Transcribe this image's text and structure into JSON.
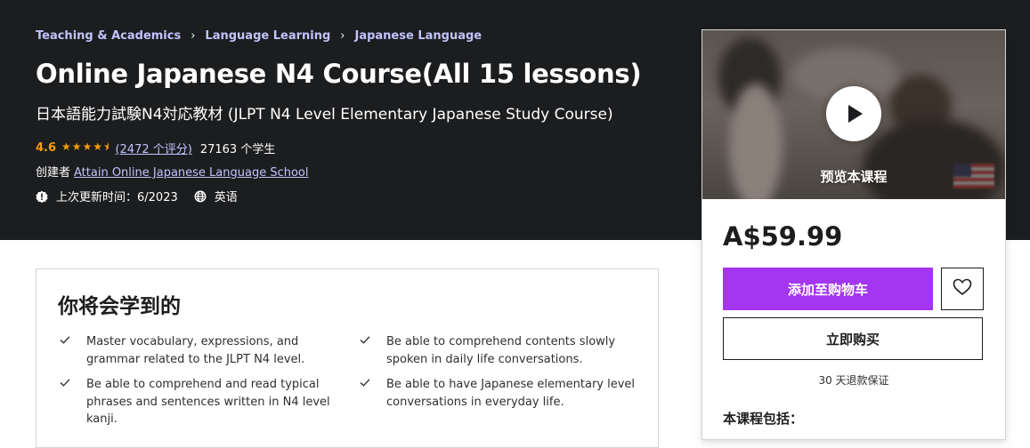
{
  "breadcrumbs": [
    "Teaching & Academics",
    "Language Learning",
    "Japanese Language"
  ],
  "course": {
    "title": "Online Japanese N4 Course(All 15 lessons)",
    "subtitle": "日本語能力試験N4対応教材 (JLPT N4 Level Elementary Japanese Study Course)",
    "rating": "4.6",
    "stars_value": 4.6,
    "rating_count": "(2472 个评分)",
    "students": "27163 个学生",
    "creator_label": "创建者",
    "creator_name": "Attain Online Japanese Language School",
    "last_updated": "上次更新时间：6/2023",
    "language": "英语"
  },
  "learn": {
    "heading": "你将会学到的",
    "items": [
      "Master vocabulary, expressions, and grammar related to the JLPT N4 level.",
      "Be able to comprehend contents slowly spoken in daily life conversations.",
      "Be able to comprehend and read typical phrases and sentences written in N4 level kanji.",
      "Be able to have Japanese elementary level conversations in everyday life."
    ]
  },
  "sidebar": {
    "preview_label": "预览本课程",
    "price": "A$59.99",
    "add_to_cart": "添加至购物车",
    "buy_now": "立即购买",
    "guarantee": "30 天退款保证",
    "includes_heading": "本课程包括："
  },
  "icons": {
    "crumb_separator": "chevron-right-icon",
    "star": "star-icon",
    "alert": "alert-icon",
    "globe": "globe-icon",
    "check": "check-icon",
    "heart": "heart-icon",
    "play": "play-icon",
    "flag": "us-flag-icon"
  },
  "colors": {
    "hero_bg": "#1c1d1f",
    "accent_purple": "#a435f0",
    "link_lavender": "#c0c4fc",
    "star_orange": "#f69c08"
  }
}
